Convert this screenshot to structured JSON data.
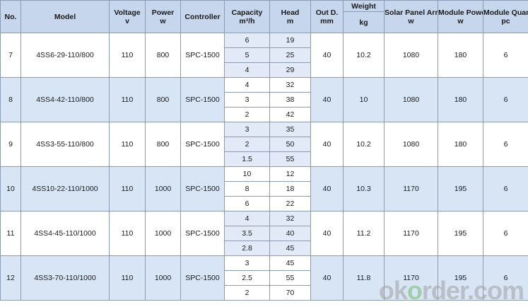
{
  "headers": {
    "no": "No.",
    "model": "Model",
    "voltage": "Voltage",
    "voltage_unit": "v",
    "power": "Power",
    "power_unit": "w",
    "controller": "Controller",
    "capacity": "Capacity",
    "capacity_unit": "m³/h",
    "head": "Head",
    "head_unit": "m",
    "outd": "Out D.",
    "outd_unit": "mm",
    "weight": "Weight",
    "weight_unit": "kg",
    "solar": "Solar Panel Array Power",
    "solar_unit": "w",
    "module_power": "Module Power",
    "module_power_unit": "w",
    "module_qty": "Module Quantity",
    "module_qty_unit": "pc"
  },
  "rows": [
    {
      "no": "7",
      "model": "4SS6-29-110/800",
      "voltage": "110",
      "power": "800",
      "controller": "SPC-1500",
      "pairs": [
        {
          "capacity": "6",
          "head": "19"
        },
        {
          "capacity": "5",
          "head": "25"
        },
        {
          "capacity": "4",
          "head": "29"
        }
      ],
      "outd": "40",
      "weight": "10.2",
      "solar": "1080",
      "module_power": "180",
      "module_qty": "6"
    },
    {
      "no": "8",
      "model": "4SS4-42-110/800",
      "voltage": "110",
      "power": "800",
      "controller": "SPC-1500",
      "pairs": [
        {
          "capacity": "4",
          "head": "32"
        },
        {
          "capacity": "3",
          "head": "38"
        },
        {
          "capacity": "2",
          "head": "42"
        }
      ],
      "outd": "40",
      "weight": "10",
      "solar": "1080",
      "module_power": "180",
      "module_qty": "6"
    },
    {
      "no": "9",
      "model": "4SS3-55-110/800",
      "voltage": "110",
      "power": "800",
      "controller": "SPC-1500",
      "pairs": [
        {
          "capacity": "3",
          "head": "35"
        },
        {
          "capacity": "2",
          "head": "50"
        },
        {
          "capacity": "1.5",
          "head": "55"
        }
      ],
      "outd": "40",
      "weight": "10.2",
      "solar": "1080",
      "module_power": "180",
      "module_qty": "6"
    },
    {
      "no": "10",
      "model": "4SS10-22-110/1000",
      "voltage": "110",
      "power": "1000",
      "controller": "SPC-1500",
      "pairs": [
        {
          "capacity": "10",
          "head": "12"
        },
        {
          "capacity": "8",
          "head": "18"
        },
        {
          "capacity": "6",
          "head": "22"
        }
      ],
      "outd": "40",
      "weight": "10.3",
      "solar": "1170",
      "module_power": "195",
      "module_qty": "6"
    },
    {
      "no": "11",
      "model": "4SS4-45-110/1000",
      "voltage": "110",
      "power": "1000",
      "controller": "SPC-1500",
      "pairs": [
        {
          "capacity": "4",
          "head": "32"
        },
        {
          "capacity": "3.5",
          "head": "40"
        },
        {
          "capacity": "2.8",
          "head": "45"
        }
      ],
      "outd": "40",
      "weight": "11.2",
      "solar": "1170",
      "module_power": "195",
      "module_qty": "6"
    },
    {
      "no": "12",
      "model": "4SS3-70-110/1000",
      "voltage": "110",
      "power": "1000",
      "controller": "SPC-1500",
      "pairs": [
        {
          "capacity": "3",
          "head": "45"
        },
        {
          "capacity": "2.5",
          "head": "55"
        },
        {
          "capacity": "2",
          "head": "70"
        }
      ],
      "outd": "40",
      "weight": "11.8",
      "solar": "1170",
      "module_power": "195",
      "module_qty": "6"
    }
  ],
  "watermark": {
    "prefix": "ok",
    "o": "o",
    "suffix": "rder.com"
  }
}
